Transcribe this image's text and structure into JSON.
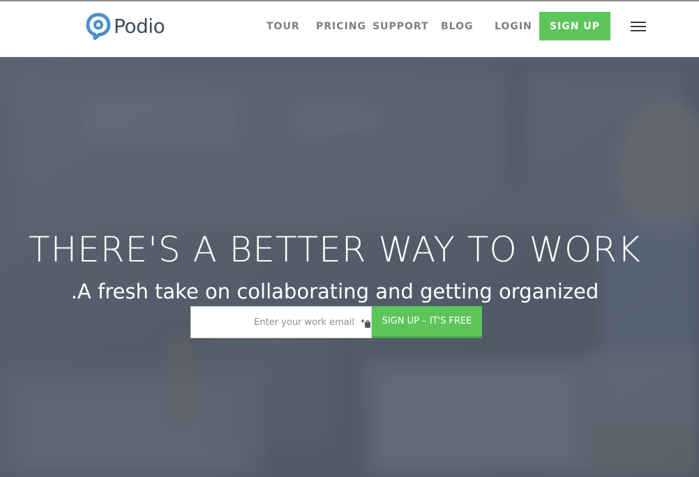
{
  "brand": {
    "name": "Podio",
    "accent": "#4a90c8",
    "icon": "podio-logo-icon"
  },
  "nav": {
    "items": [
      {
        "label": "TOUR"
      },
      {
        "label": "PRICING"
      },
      {
        "label": "SUPPORT"
      },
      {
        "label": "BLOG"
      },
      {
        "label": "LOGIN"
      }
    ],
    "signup_label": "SIGN UP",
    "signup_color": "#5ec55b",
    "menu_icon": "hamburger-menu-icon"
  },
  "hero": {
    "headline": "THERE'S A BETTER WAY TO WORK",
    "subheadline": ".A fresh take on collaborating and getting organized",
    "email_placeholder": "Enter your work email",
    "email_value": "",
    "submit_label": "SIGN UP – IT'S FREE",
    "overlay_color": "#4f5866"
  }
}
